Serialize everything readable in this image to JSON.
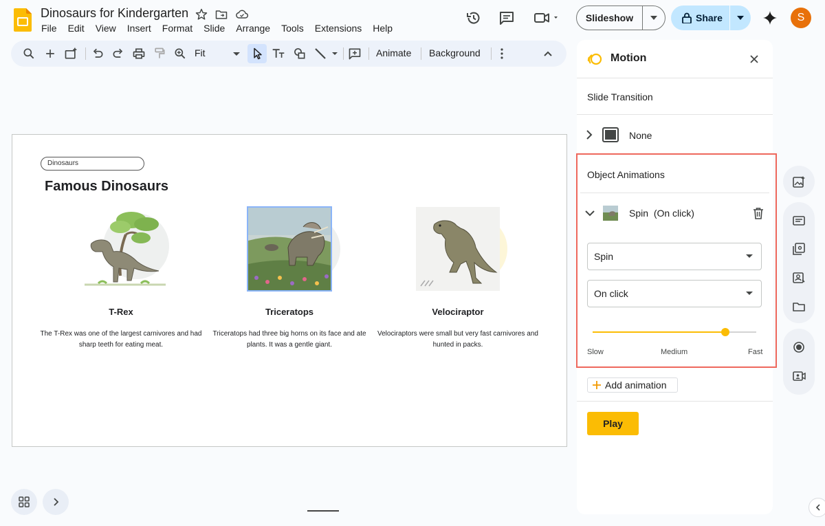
{
  "app": {
    "doc_title": "Dinosaurs for Kindergarten",
    "menu": [
      "File",
      "Edit",
      "View",
      "Insert",
      "Format",
      "Slide",
      "Arrange",
      "Tools",
      "Extensions",
      "Help"
    ],
    "slideshow_label": "Slideshow",
    "share_label": "Share",
    "avatar_initial": "S"
  },
  "toolbar": {
    "zoom_value": "Fit",
    "animate_label": "Animate",
    "background_label": "Background"
  },
  "slide": {
    "tag": "Dinosaurs",
    "title": "Famous Dinosaurs",
    "cards": [
      {
        "name": "T-Rex",
        "desc": "The T-Rex was one of the largest carnivores and had sharp teeth for eating meat."
      },
      {
        "name": "Triceratops",
        "desc": "Triceratops had three big horns on its face and ate plants. It was a gentle giant."
      },
      {
        "name": "Velociraptor",
        "desc": "Velociraptors were small but very fast carnivores and hunted in packs."
      }
    ]
  },
  "motion_panel": {
    "title": "Motion",
    "slide_transition_heading": "Slide Transition",
    "transition_value": "None",
    "object_animations_heading": "Object Animations",
    "animation_item_name": "Spin",
    "animation_item_trigger": "(On click)",
    "effect_select": "Spin",
    "trigger_select": "On click",
    "speed": {
      "value_fraction": 0.81,
      "min_label": "Slow",
      "mid_label": "Medium",
      "max_label": "Fast"
    },
    "add_animation_label": "Add animation",
    "play_label": "Play"
  },
  "colors": {
    "accent_yellow": "#fbbc04",
    "highlight_red": "#ee675c",
    "share_blue": "#c2e7ff",
    "avatar_orange": "#e8710a"
  }
}
